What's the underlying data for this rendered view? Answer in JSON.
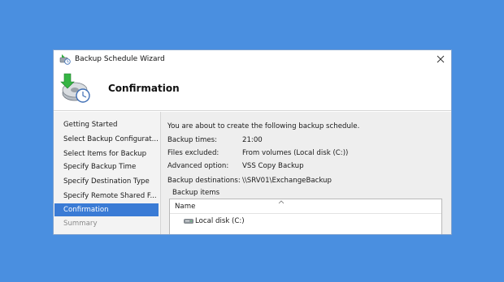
{
  "window": {
    "title": "Backup Schedule Wizard",
    "page_title": "Confirmation"
  },
  "sidebar": {
    "items": [
      {
        "label": "Getting Started",
        "state": "normal"
      },
      {
        "label": "Select Backup Configurat...",
        "state": "normal"
      },
      {
        "label": "Select Items for Backup",
        "state": "normal"
      },
      {
        "label": "Specify Backup Time",
        "state": "normal"
      },
      {
        "label": "Specify Destination Type",
        "state": "normal"
      },
      {
        "label": "Specify Remote Shared F...",
        "state": "normal"
      },
      {
        "label": "Confirmation",
        "state": "active"
      },
      {
        "label": "Summary",
        "state": "disabled"
      }
    ]
  },
  "content": {
    "intro": "You are about to create the following backup schedule.",
    "details": [
      {
        "key": "Backup times:",
        "value": "21:00"
      },
      {
        "key": "Files excluded:",
        "value": "From volumes (Local disk (C:))"
      },
      {
        "key": "Advanced option:",
        "value": "VSS Copy Backup"
      },
      {
        "key": "Backup destinations:",
        "value": "\\\\SRV01\\ExchangeBackup"
      }
    ],
    "items_label": "Backup items",
    "list": {
      "column": "Name",
      "rows": [
        "Local disk (C:)"
      ]
    }
  },
  "colors": {
    "desktop": "#4a8fe0",
    "selection": "#3a7bd5"
  },
  "icons": [
    "wizard-app-icon",
    "close-icon",
    "backup-wizard-icon",
    "sort-up-icon",
    "disk-icon"
  ]
}
